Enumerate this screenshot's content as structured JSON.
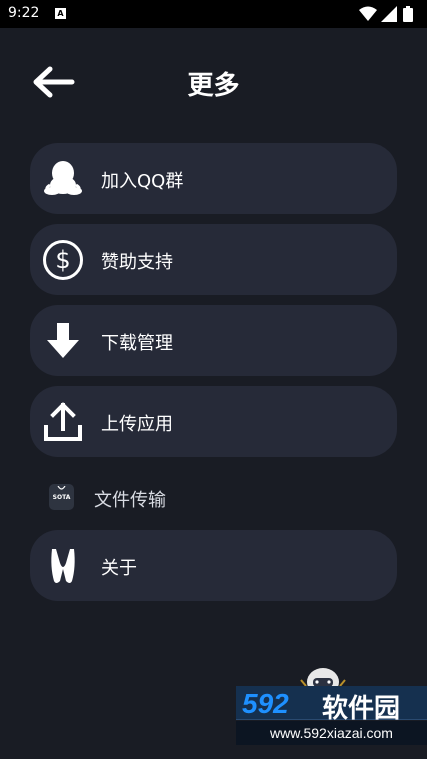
{
  "status_bar": {
    "time": "9:22",
    "notification_letter": "A"
  },
  "header": {
    "title": "更多"
  },
  "menu": {
    "items": [
      {
        "label": "加入QQ群",
        "icon": "qq-penguin-icon"
      },
      {
        "label": "赞助支持",
        "icon": "dollar-circle-icon"
      },
      {
        "label": "下载管理",
        "icon": "download-arrow-icon"
      },
      {
        "label": "上传应用",
        "icon": "upload-icon"
      }
    ],
    "plain_item": {
      "label": "文件传输",
      "icon_text": "SOTA",
      "icon": "sota-icon"
    },
    "about": {
      "label": "关于",
      "icon": "app-logo-icon"
    }
  },
  "watermark": {
    "brand_number": "592",
    "brand_text": "软件园",
    "url": "www.592xiazai.com"
  },
  "colors": {
    "background": "#191c24",
    "card": "#262a38",
    "brand_blue": "#1e90ff"
  }
}
